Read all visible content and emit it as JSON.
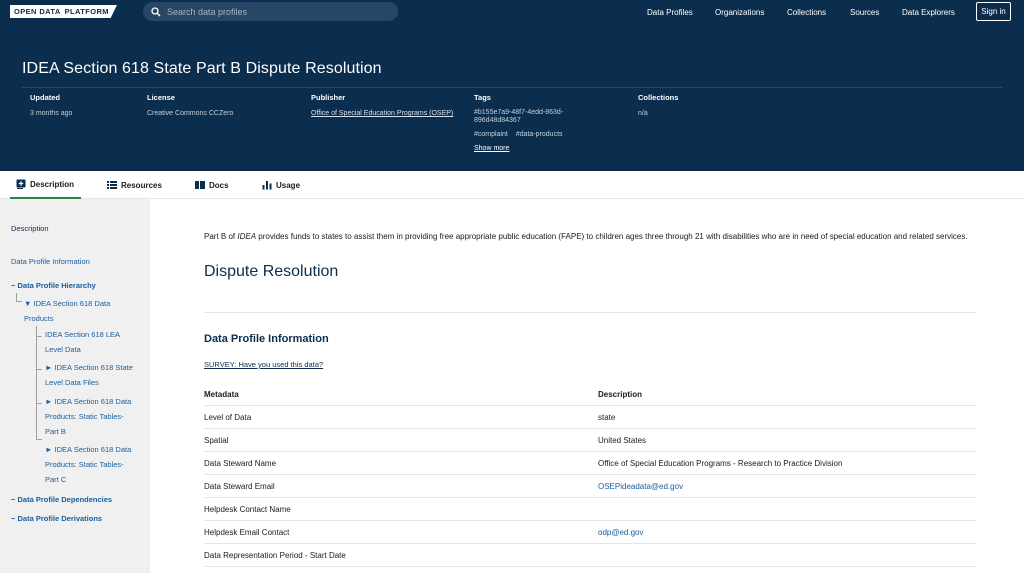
{
  "nav": {
    "logo_part1": "OPEN DATA",
    "logo_part2": "PLATFORM",
    "search_placeholder": "Search data profiles",
    "links": [
      "Data Profiles",
      "Organizations",
      "Collections",
      "Sources",
      "Data Explorers"
    ],
    "signin": "Sign in"
  },
  "header": {
    "title": "IDEA Section 618 State Part B Dispute Resolution",
    "updated_label": "Updated",
    "updated_value": "3 months ago",
    "license_label": "License",
    "license_value": "Creative Commons CCZero",
    "publisher_label": "Publisher",
    "publisher_value": "Office of Special Education Programs (OSEP)",
    "tags_label": "Tags",
    "tags_id_line1": "#b155e7a9-48f7-4edd-863d-",
    "tags_id_line2": "896d48d84367",
    "tag_complaint": "#complaint",
    "tag_data_products": "#data-products",
    "show_more": "Show more",
    "collections_label": "Collections",
    "collections_value": "n/a"
  },
  "tabs": [
    {
      "label": "Description",
      "icon": "plus-box-icon"
    },
    {
      "label": "Resources",
      "icon": "list-icon"
    },
    {
      "label": "Docs",
      "icon": "docs-icon"
    },
    {
      "label": "Usage",
      "icon": "bar-chart-icon"
    }
  ],
  "sidebar": {
    "description": "Description",
    "info": "Data Profile Information",
    "hierarchy": "Data Profile Hierarchy",
    "tree_root": "IDEA Section 618 Data Products",
    "tree_lea": "IDEA Section 618 LEA Level Data",
    "tree_state": "IDEA Section 618 State Level Data Files",
    "tree_static_b": "IDEA Section 618 Data Products: Static Tables- Part B",
    "tree_static_c": "IDEA Section 618 Data Products: Static Tables- Part C",
    "dependencies": "Data Profile Dependencies",
    "derivations": "Data Profile Derivations"
  },
  "main": {
    "intro_before": "Part B of ",
    "intro_em": "IDEA",
    "intro_after": " provides funds to states to assist them in providing free appropriate public education (FAPE) to children ages three through 21 with disabilities who are in need of special education and related services.",
    "section_title": "Dispute Resolution",
    "info_title": "Data Profile Information",
    "survey": "SURVEY: Have you used this data?",
    "table_headers": [
      "Metadata",
      "Description"
    ],
    "rows": [
      {
        "key": "Level of Data",
        "value": "state"
      },
      {
        "key": "Spatial",
        "value": "United States"
      },
      {
        "key": "Data Steward Name",
        "value": "Office of Special Education Programs - Research to Practice Division"
      },
      {
        "key": "Data Steward Email",
        "value": "OSEPideadata@ed.gov"
      },
      {
        "key": "Helpdesk Contact Name",
        "value": ""
      },
      {
        "key": "Helpdesk Email Contact",
        "value": "odp@ed.gov"
      },
      {
        "key": "Data Representation Period - Start Date",
        "value": ""
      }
    ]
  },
  "colors": {
    "navy": "#0b2d4e",
    "accent_green": "#2e8540",
    "link_blue": "#1a5ea0"
  }
}
